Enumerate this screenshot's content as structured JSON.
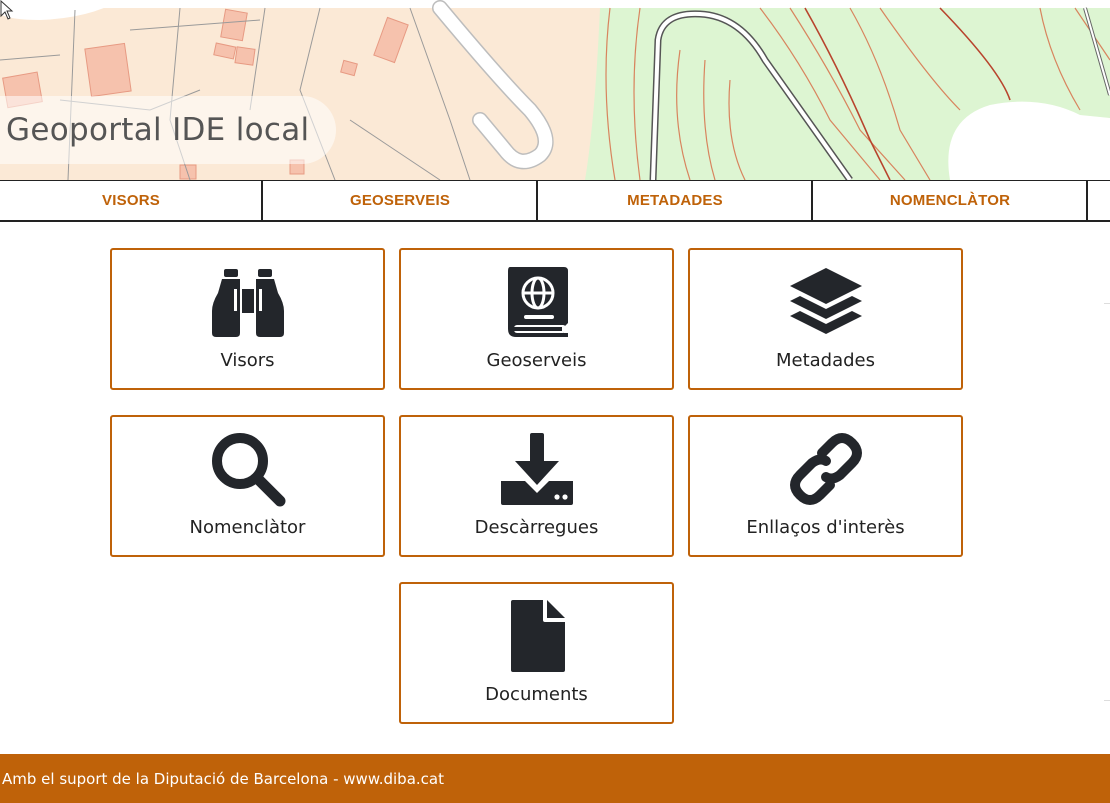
{
  "header": {
    "site_title": "Geoportal IDE local"
  },
  "navbar": {
    "items": [
      {
        "label": "VISORS"
      },
      {
        "label": "GEOSERVEIS"
      },
      {
        "label": "METADADES"
      },
      {
        "label": "NOMENCLÀTOR"
      }
    ]
  },
  "tiles": [
    {
      "label": "Visors",
      "icon": "binoculars-icon"
    },
    {
      "label": "Geoserveis",
      "icon": "globe-book-icon"
    },
    {
      "label": "Metadades",
      "icon": "layers-icon"
    },
    {
      "label": "Nomenclàtor",
      "icon": "search-icon"
    },
    {
      "label": "Descàrregues",
      "icon": "download-icon"
    },
    {
      "label": "Enllaços d'interès",
      "icon": "link-icon"
    },
    {
      "label": "Documents",
      "icon": "document-icon"
    }
  ],
  "footer": {
    "text": "Amb el suport de la Diputació de Barcelona - www.diba.cat"
  },
  "colors": {
    "accent": "#bf6209",
    "icon": "#23262b",
    "map_background": "#fbe9d6",
    "map_green": "#ddf5d2"
  }
}
